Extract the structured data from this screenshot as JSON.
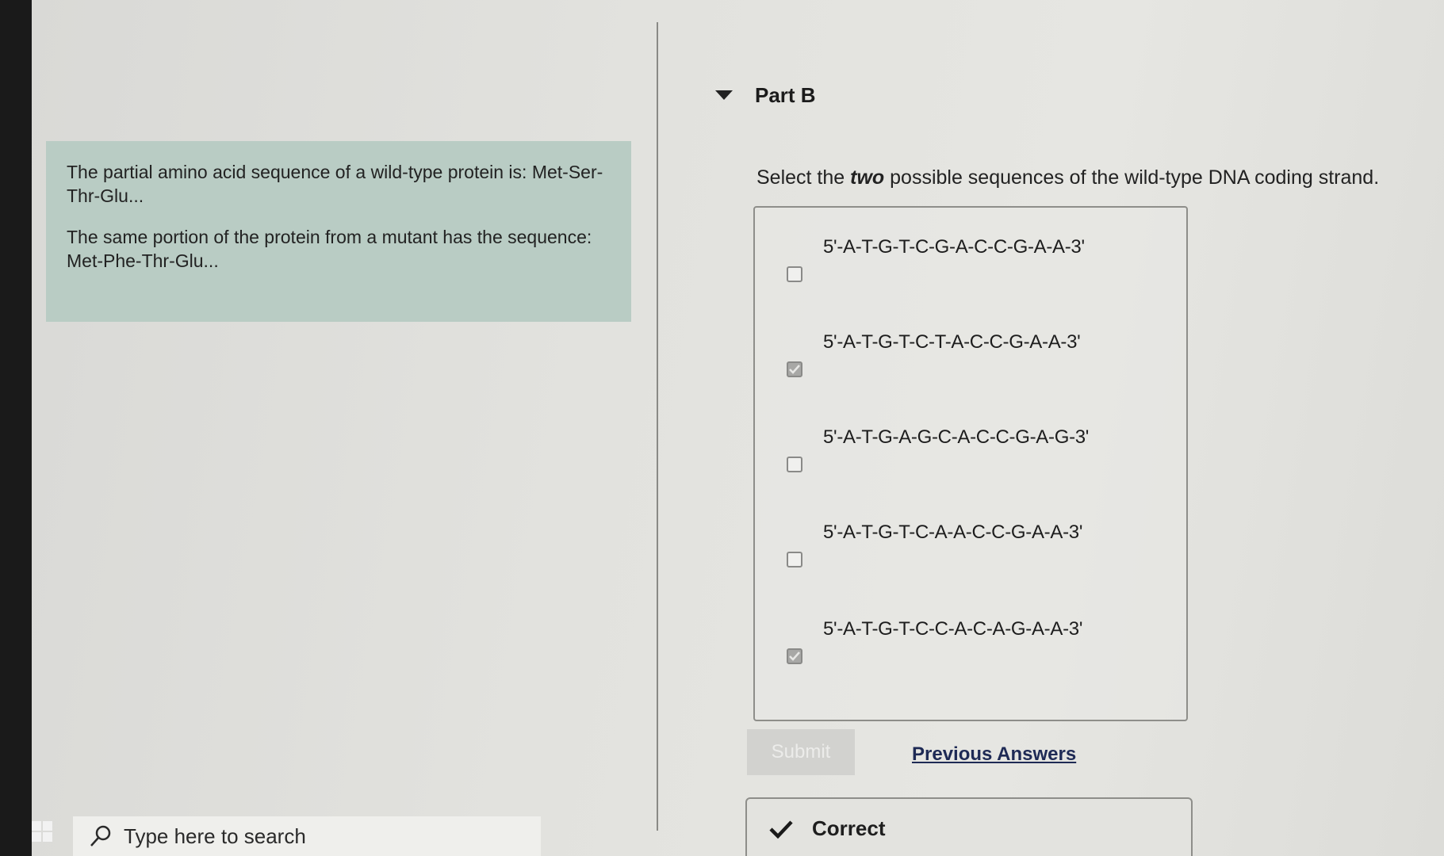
{
  "intro": {
    "paragraph1": "The partial amino acid sequence of a wild-type protein is: Met-Ser-Thr-Glu...",
    "paragraph2": "The same portion of the protein from a mutant has the sequence: Met-Phe-Thr-Glu..."
  },
  "part": {
    "title": "Part B"
  },
  "question": {
    "prompt_before": "Select the ",
    "prompt_emphasis": "two",
    "prompt_after": " possible sequences of the wild-type DNA coding strand."
  },
  "options": [
    {
      "label": "5'-A-T-G-T-C-G-A-C-C-G-A-A-3'",
      "checked": false
    },
    {
      "label": "5'-A-T-G-T-C-T-A-C-C-G-A-A-3'",
      "checked": true
    },
    {
      "label": "5'-A-T-G-A-G-C-A-C-C-G-A-G-3'",
      "checked": false
    },
    {
      "label": "5'-A-T-G-T-C-A-A-C-C-G-A-A-3'",
      "checked": false
    },
    {
      "label": "5'-A-T-G-T-C-C-A-C-A-G-A-A-3'",
      "checked": true
    }
  ],
  "actions": {
    "submit_label": "Submit",
    "previous_answers_label": "Previous Answers"
  },
  "result": {
    "text": "Correct",
    "icon": "checkmark-icon"
  },
  "taskbar": {
    "search_placeholder": "Type here to search"
  },
  "colors": {
    "intro_bg": "#b9ccc4",
    "check_color": "#1a1a1a",
    "link_color": "#1e2a55"
  }
}
